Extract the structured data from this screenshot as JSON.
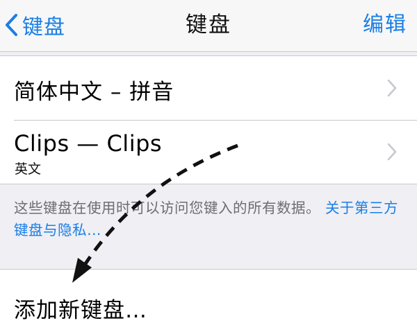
{
  "navbar": {
    "back_label": "键盘",
    "title": "键盘",
    "edit_label": "编辑"
  },
  "keyboards": [
    {
      "title": "简体中文 – 拼音",
      "subtitle": ""
    },
    {
      "title": "Clips — Clips",
      "subtitle": "英文"
    }
  ],
  "footer": {
    "note_text": "这些键盘在使用时可以访问您键入的所有数据。",
    "link_text": "关于第三方键盘与隐私…"
  },
  "add_keyboard": {
    "label": "添加新键盘…"
  },
  "colors": {
    "accent": "#1a7ee6",
    "background": "#efeff4",
    "separator": "#c8c7cc"
  },
  "icons": {
    "back": "chevron-left-icon",
    "disclosure": "chevron-right-icon"
  }
}
